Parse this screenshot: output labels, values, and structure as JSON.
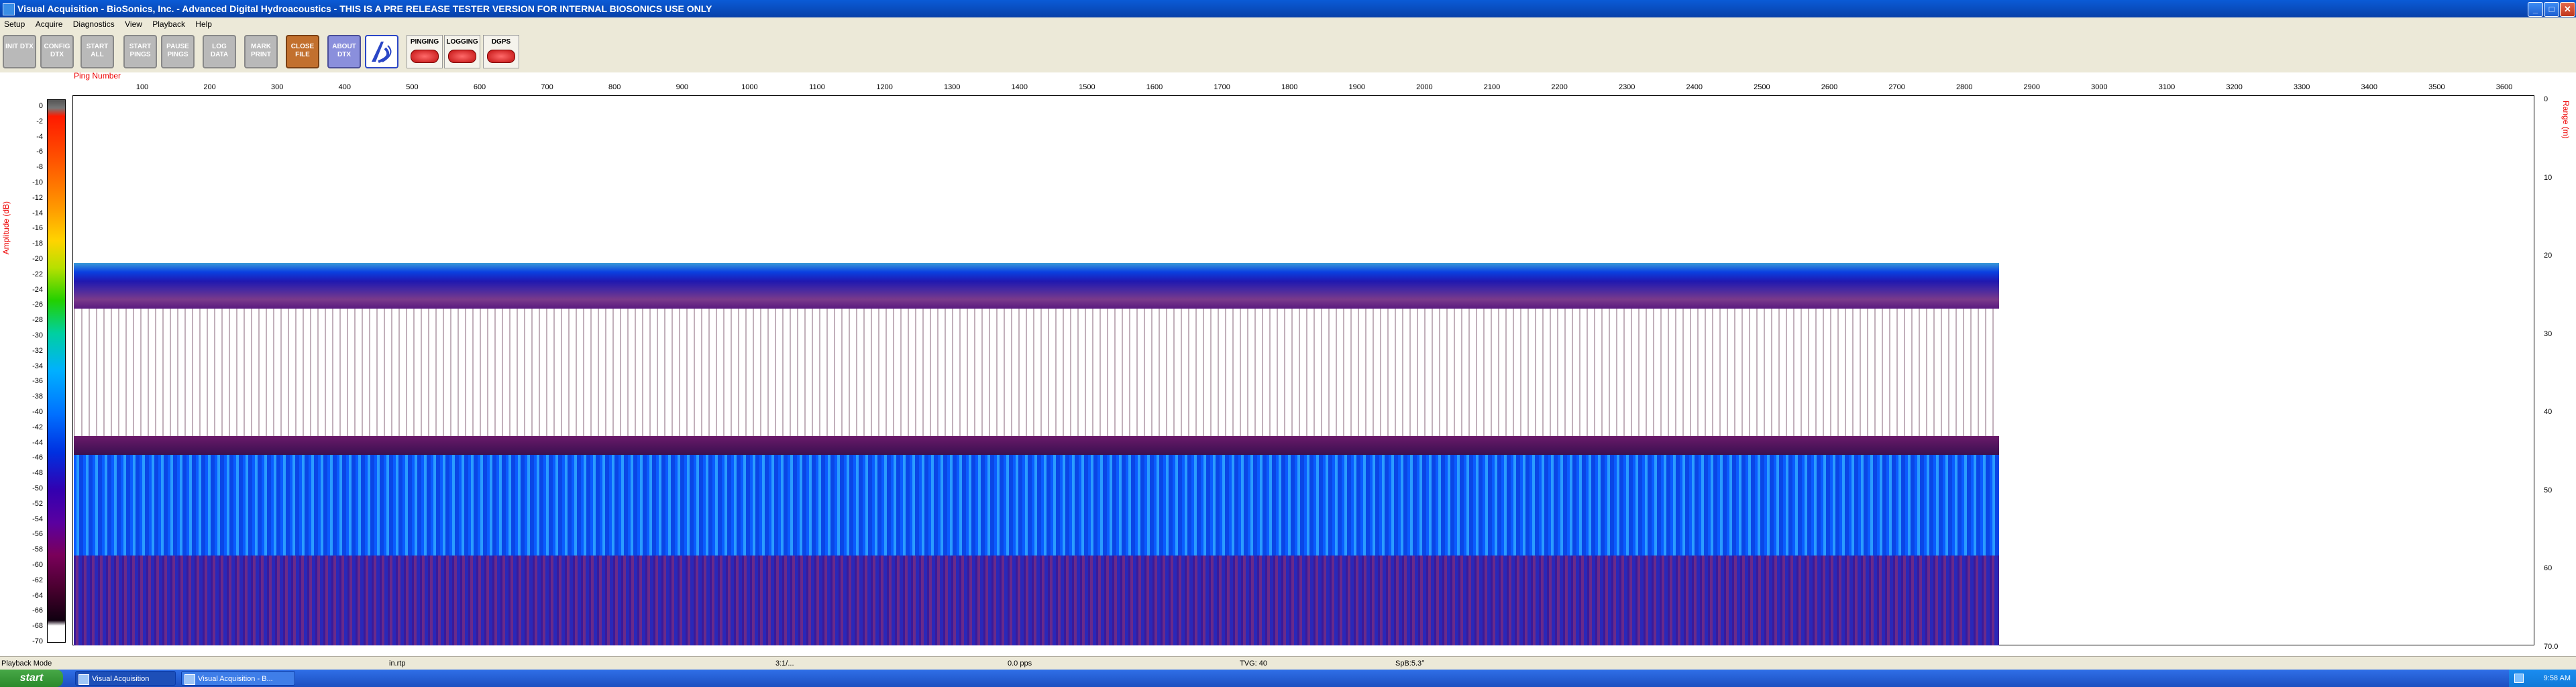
{
  "window": {
    "title": "Visual Acquisition  -  BioSonics, Inc.  -  Advanced Digital Hydroacoustics  -  THIS IS A PRE RELEASE TESTER VERSION FOR INTERNAL BIOSONICS USE ONLY",
    "minimize": "_",
    "maximize": "□",
    "close": "✕"
  },
  "menu": [
    "Setup",
    "Acquire",
    "Diagnostics",
    "View",
    "Playback",
    "Help"
  ],
  "toolbar": {
    "buttons": [
      {
        "label": "INIT DTX"
      },
      {
        "label": "CONFIG DTX"
      },
      {
        "label": "START ALL"
      },
      {
        "label": "START PINGS"
      },
      {
        "label": "PAUSE PINGS"
      },
      {
        "label": "LOG DATA"
      },
      {
        "label": "MARK PRINT"
      },
      {
        "label": "CLOSE FILE"
      },
      {
        "label": "ABOUT DTX"
      }
    ],
    "indicators": [
      {
        "label": "PINGING",
        "state": "OFF"
      },
      {
        "label": "LOGGING",
        "state": "OFF"
      },
      {
        "label": "DGPS",
        "state": "OFF"
      }
    ]
  },
  "echogram": {
    "ping_label": "Ping Number",
    "amp_label": "Amplitude (dB)",
    "range_label": "Range (m)",
    "ping_ticks": [
      "100",
      "200",
      "300",
      "400",
      "500",
      "600",
      "700",
      "800",
      "900",
      "1000",
      "1100",
      "1200",
      "1300",
      "1400",
      "1500",
      "1600",
      "1700",
      "1800",
      "1900",
      "2000",
      "2100",
      "2200",
      "2300",
      "2400",
      "2500",
      "2600",
      "2700",
      "2800",
      "2900",
      "3000",
      "3100",
      "3200",
      "3300",
      "3400",
      "3500",
      "3600"
    ],
    "amp_ticks": [
      "0",
      "-2",
      "-4",
      "-6",
      "-8",
      "-10",
      "-12",
      "-14",
      "-16",
      "-18",
      "-20",
      "-22",
      "-24",
      "-26",
      "-28",
      "-30",
      "-32",
      "-34",
      "-36",
      "-38",
      "-40",
      "-42",
      "-44",
      "-46",
      "-48",
      "-50",
      "-52",
      "-54",
      "-56",
      "-58",
      "-60",
      "-62",
      "-64",
      "-66",
      "-68",
      "-70"
    ],
    "range_ticks": [
      "0",
      "10",
      "20",
      "30",
      "40",
      "50",
      "60",
      "70.0"
    ],
    "data_extent_pings": 2870,
    "colors": {
      "surface": "#0a3fe0",
      "deep": "#0a50ff",
      "bottom": "#3a1a9a"
    }
  },
  "status": {
    "mode": "Playback Mode",
    "file": "in.rtp",
    "time": "3:1/...",
    "rate": "0.0 pps",
    "tvg": "TVG: 40",
    "spb": "SpB:5.3°"
  },
  "taskbar": {
    "start": "start",
    "tasks": [
      "Visual Acquisition",
      "Visual Acquisition - B..."
    ],
    "clock": "9:58 AM"
  }
}
